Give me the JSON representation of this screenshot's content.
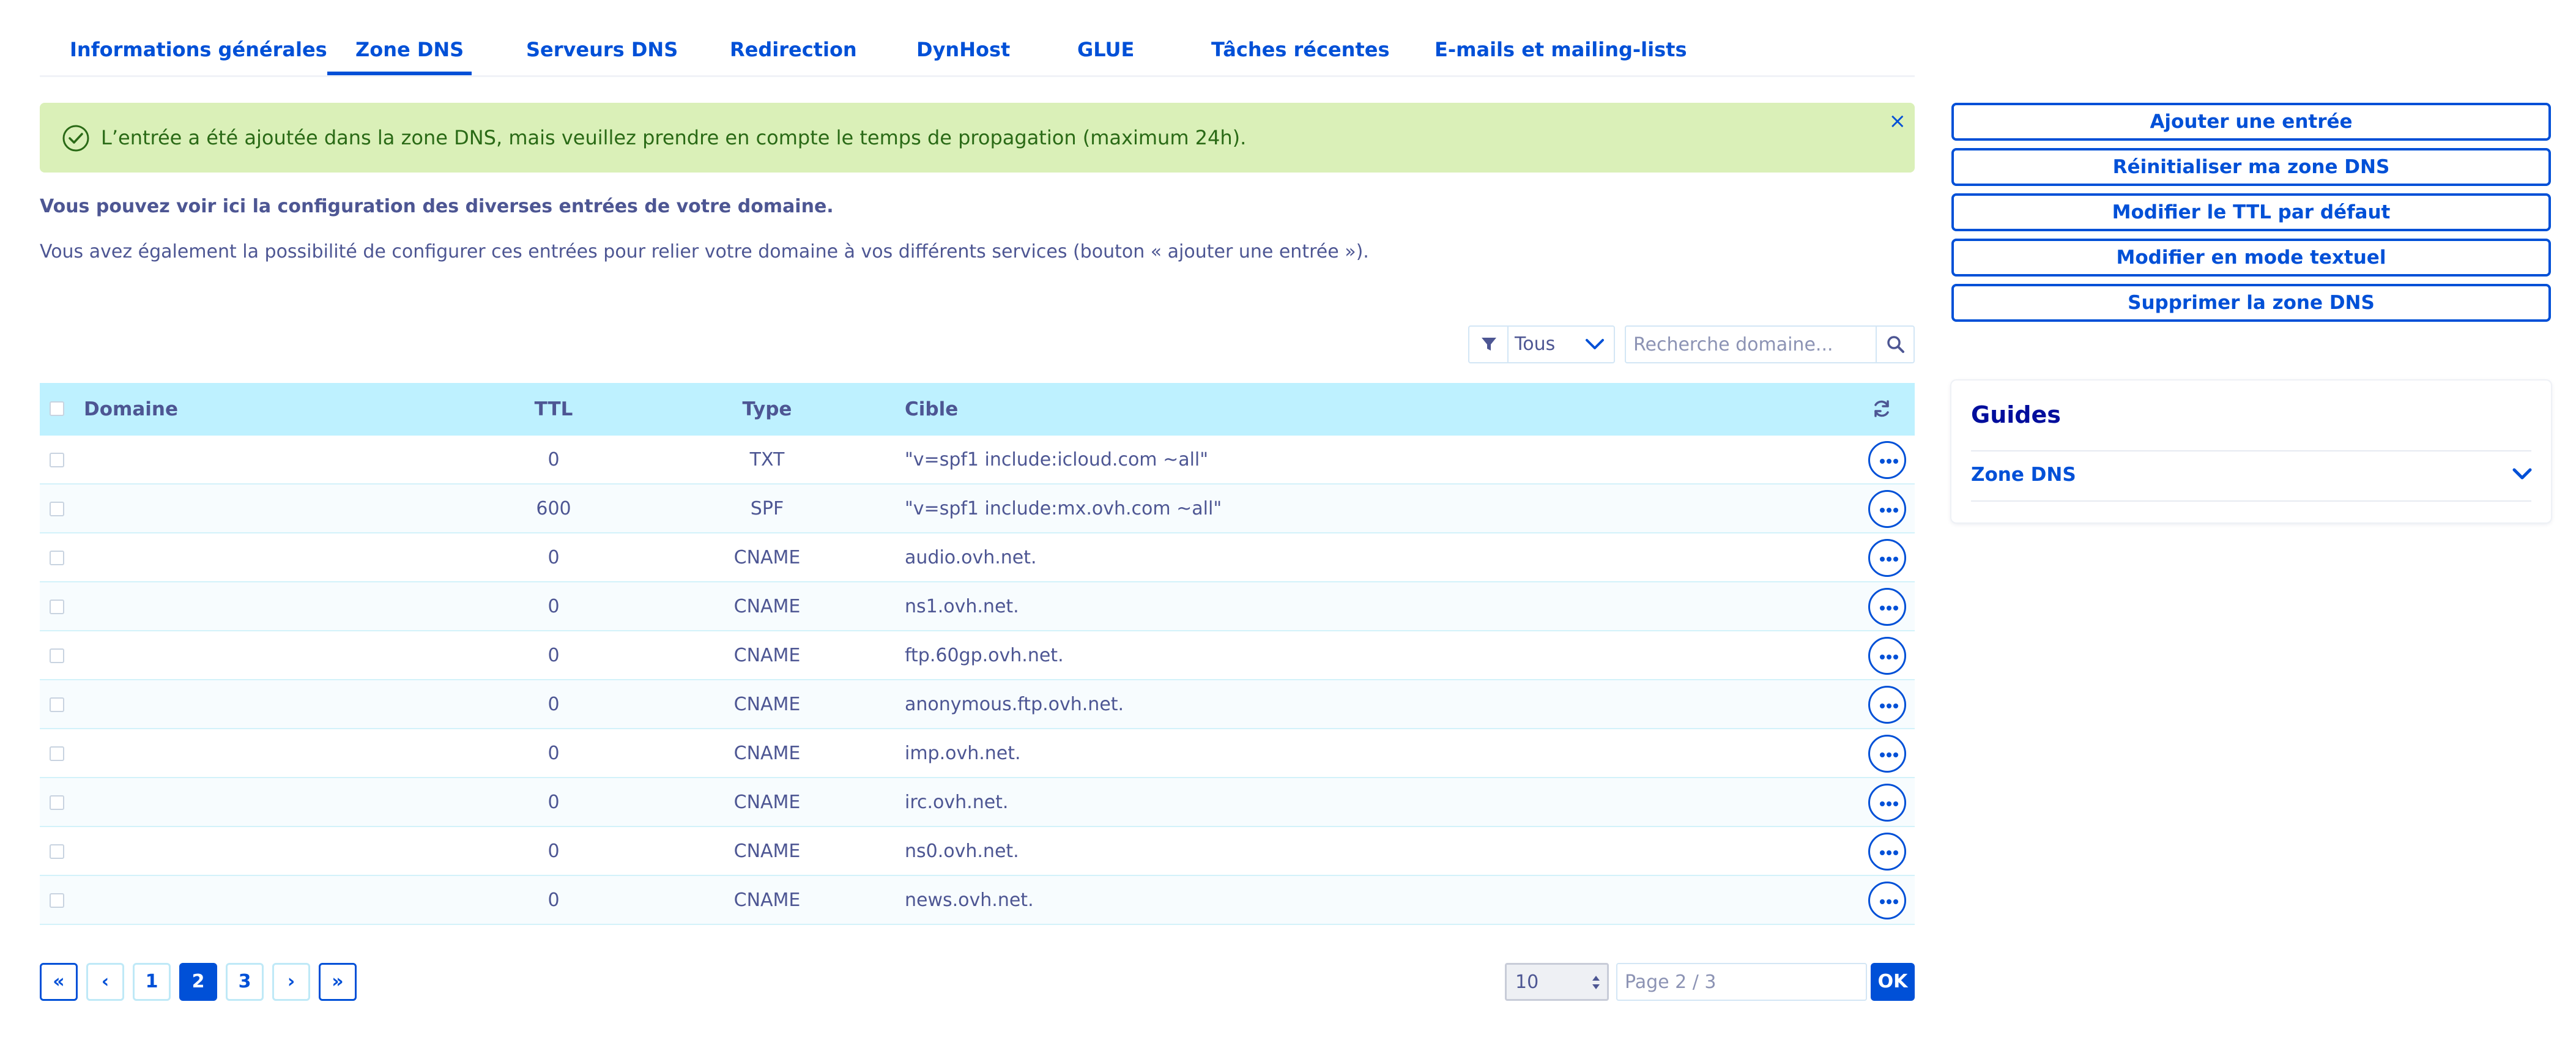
{
  "tabs": [
    {
      "label": "Informations générales",
      "active": false
    },
    {
      "label": "Zone DNS",
      "active": true
    },
    {
      "label": "Serveurs DNS",
      "active": false
    },
    {
      "label": "Redirection",
      "active": false
    },
    {
      "label": "DynHost",
      "active": false
    },
    {
      "label": "GLUE",
      "active": false
    },
    {
      "label": "Tâches récentes",
      "active": false
    },
    {
      "label": "E-mails et mailing-lists",
      "active": false
    }
  ],
  "alert": {
    "message": "L’entrée a été ajoutée dans la zone DNS, mais veuillez prendre en compte le temps de propagation (maximum 24h).",
    "close": "×"
  },
  "intro": {
    "bold": "Vous pouvez voir ici la configuration des diverses entrées de votre domaine.",
    "text": "Vous avez également la possibilité de configurer ces entrées pour relier votre domaine à vos différents services (bouton « ajouter une entrée »)."
  },
  "filter": {
    "value": "Tous"
  },
  "search": {
    "placeholder": "Recherche domaine..."
  },
  "table": {
    "headers": {
      "domain": "Domaine",
      "ttl": "TTL",
      "type": "Type",
      "target": "Cible"
    },
    "rows": [
      {
        "domain": "",
        "ttl": "0",
        "type": "TXT",
        "target": "\"v=spf1 include:icloud.com ~all\""
      },
      {
        "domain": "",
        "ttl": "600",
        "type": "SPF",
        "target": "\"v=spf1 include:mx.ovh.com ~all\""
      },
      {
        "domain": "",
        "ttl": "0",
        "type": "CNAME",
        "target": "audio.ovh.net."
      },
      {
        "domain": "",
        "ttl": "0",
        "type": "CNAME",
        "target": "ns1.ovh.net."
      },
      {
        "domain": "",
        "ttl": "0",
        "type": "CNAME",
        "target": "ftp.60gp.ovh.net."
      },
      {
        "domain": "",
        "ttl": "0",
        "type": "CNAME",
        "target": "anonymous.ftp.ovh.net."
      },
      {
        "domain": "",
        "ttl": "0",
        "type": "CNAME",
        "target": "imp.ovh.net."
      },
      {
        "domain": "",
        "ttl": "0",
        "type": "CNAME",
        "target": "irc.ovh.net."
      },
      {
        "domain": "",
        "ttl": "0",
        "type": "CNAME",
        "target": "ns0.ovh.net."
      },
      {
        "domain": "",
        "ttl": "0",
        "type": "CNAME",
        "target": "news.ovh.net."
      }
    ]
  },
  "pagination": {
    "first": "«",
    "prev": "‹",
    "pages": [
      "1",
      "2",
      "3"
    ],
    "current": "2",
    "next": "›",
    "last": "»",
    "per_page": "10",
    "page_info": "Page 2 / 3",
    "ok": "OK"
  },
  "actions": [
    "Ajouter une entrée",
    "Réinitialiser ma zone DNS",
    "Modifier le TTL par défaut",
    "Modifier en mode textuel",
    "Supprimer la zone DNS"
  ],
  "guides": {
    "title": "Guides",
    "item": "Zone DNS"
  },
  "colors": {
    "primary": "#0050d7",
    "header_bg": "#bef1ff",
    "alert_bg": "#daf0b8",
    "alert_text": "#2a6a16",
    "text": "#4d5693"
  }
}
